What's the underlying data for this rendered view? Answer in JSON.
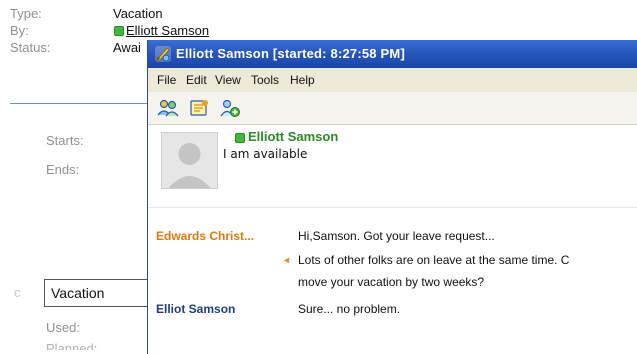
{
  "leave_form": {
    "type_label": "Type:",
    "type_value": "Vacation",
    "by_label": "By:",
    "by_value": "Elliott Samson",
    "status_label": "Status:",
    "status_value": "Awai",
    "starts_label": "Starts:",
    "ends_label": "Ends:",
    "leave_type_value": "Vacation",
    "used_label": "Used:",
    "planned_label": "Planned:"
  },
  "chat_window": {
    "title": "Elliott Samson [started: 8:27:58 PM]",
    "menu": [
      "File",
      "Edit",
      "View",
      "Tools",
      "Help"
    ],
    "toolbar_icons": [
      "contacts-icon",
      "notes-icon",
      "add-contact-icon"
    ],
    "contact": {
      "name": "Elliott Samson",
      "status_text": "I am available",
      "presence": "available"
    },
    "messages": [
      {
        "sender": "Edwards Christ...",
        "text": "Hi,Samson. Got your leave request...",
        "color": "#e07a10"
      },
      {
        "sender": "",
        "text": "Lots of other folks are on leave at the same time. C",
        "color": "#e07a10"
      },
      {
        "sender": "",
        "text": "move your vacation by two weeks?",
        "color": "#e07a10"
      },
      {
        "sender": "Elliot Samson",
        "text": "Sure... no problem.",
        "color": "#1f3f7a"
      }
    ]
  },
  "colors": {
    "titlebar": "#2453b8",
    "available_green": "#42b83a",
    "sender_orange": "#e07a10",
    "sender_blue": "#1f3f7a"
  }
}
